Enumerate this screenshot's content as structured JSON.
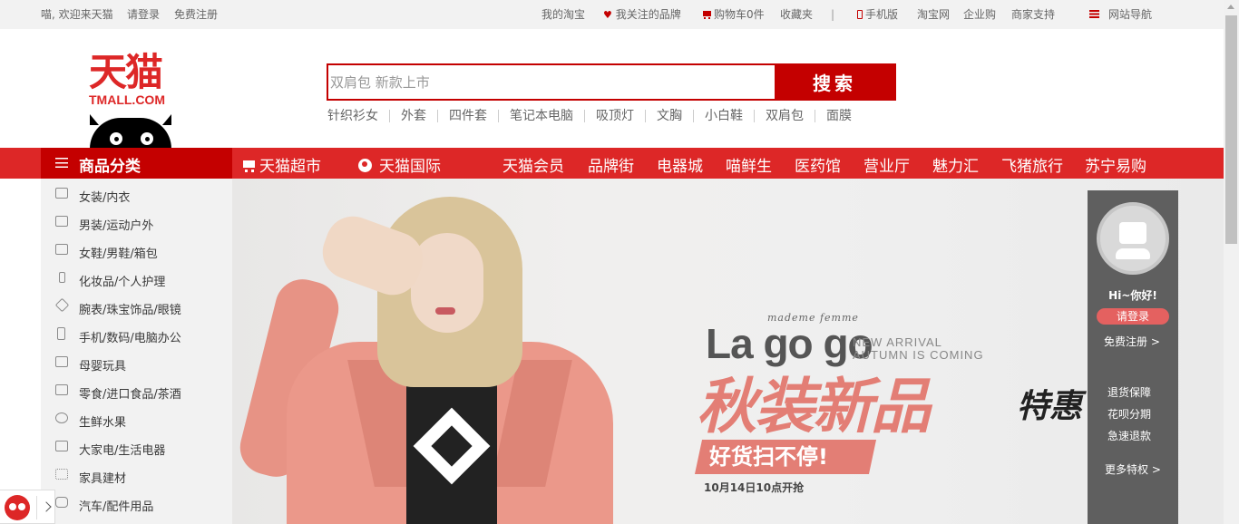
{
  "topbar": {
    "welcome": "喵, 欢迎来天猫",
    "login": "请登录",
    "register": "免费注册",
    "my_taobao": "我的淘宝",
    "fav_brands": "我关注的品牌",
    "cart": "购物车0件",
    "favorites": "收藏夹",
    "separator": "|",
    "mobile": "手机版",
    "taobao": "淘宝网",
    "enterprise": "企业购",
    "merchant": "商家支持",
    "site_nav": "网站导航"
  },
  "logo": {
    "cn": "天猫",
    "en": "TMALL.COM"
  },
  "search": {
    "placeholder": "双肩包 新款上市",
    "button": "搜索",
    "hot_words": [
      "针织衫女",
      "外套",
      "四件套",
      "笔记本电脑",
      "吸顶灯",
      "文胸",
      "小白鞋",
      "双肩包",
      "面膜"
    ]
  },
  "nav": {
    "category_tab": "商品分类",
    "items": [
      "天猫超市",
      "天猫国际",
      "天猫会员",
      "品牌街",
      "电器城",
      "喵鲜生",
      "医药馆",
      "营业厅",
      "魅力汇",
      "飞猪旅行",
      "苏宁易购"
    ]
  },
  "categories": [
    {
      "label": "女装/内衣",
      "icon": "dress-icon"
    },
    {
      "label": "男装/运动户外",
      "icon": "shirt-icon"
    },
    {
      "label": "女鞋/男鞋/箱包",
      "icon": "shoe-icon"
    },
    {
      "label": "化妆品/个人护理",
      "icon": "cosmetic-icon"
    },
    {
      "label": "腕表/珠宝饰品/眼镜",
      "icon": "diamond-icon"
    },
    {
      "label": "手机/数码/电脑办公",
      "icon": "phone-icon"
    },
    {
      "label": "母婴玩具",
      "icon": "stroller-icon"
    },
    {
      "label": "零食/进口食品/茶酒",
      "icon": "snack-icon"
    },
    {
      "label": "生鲜水果",
      "icon": "bike-icon"
    },
    {
      "label": "大家电/生活电器",
      "icon": "fridge-icon"
    },
    {
      "label": "家具建材",
      "icon": "grid-icon"
    },
    {
      "label": "汽车/配件用品",
      "icon": "car-icon"
    }
  ],
  "banner": {
    "script": "mademe femme",
    "brand": "La go go",
    "new_arrival": "NEW ARRIVAL",
    "autumn": "AUTUMN IS COMING",
    "headline": "秋装新品",
    "headline_accent": "特惠",
    "tag": "好货扫不停!",
    "date": "10月14日10点开抢"
  },
  "user_panel": {
    "greeting": "Hi~你好!",
    "login": "请登录",
    "register": "免费注册 >",
    "privileges": [
      "退货保障",
      "花呗分期",
      "急速退款"
    ],
    "more": "更多特权 >"
  },
  "colors": {
    "brand_red": "#dd2727",
    "dark_red": "#c40000",
    "pink": "#e37e75"
  }
}
